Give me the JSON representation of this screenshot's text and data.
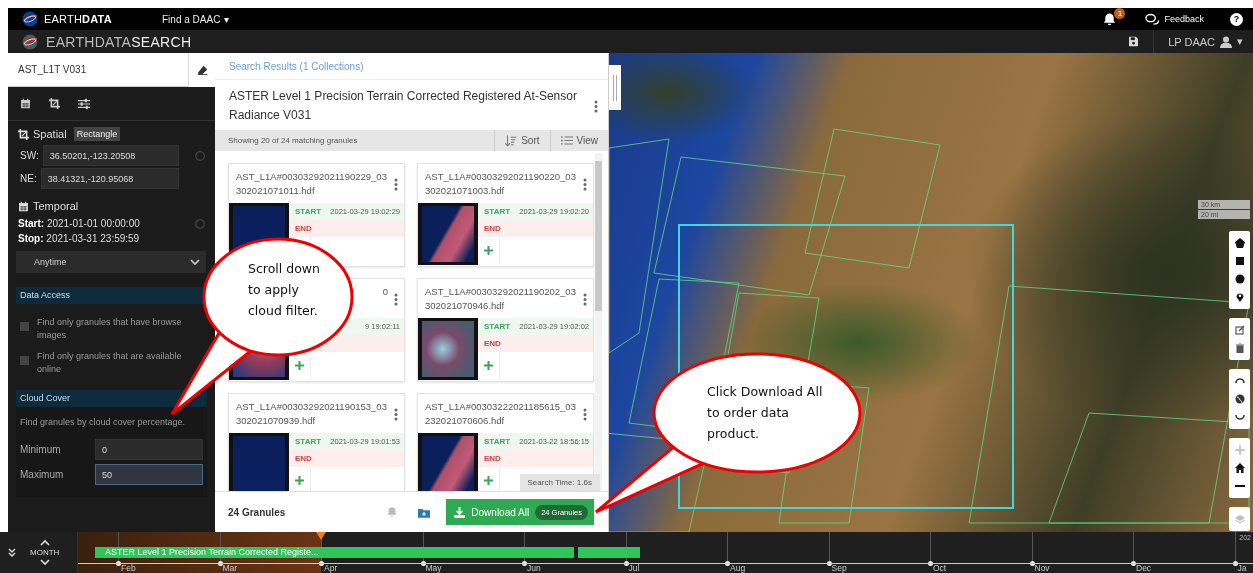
{
  "top_bar": {
    "brand": "EARTH**DATA**",
    "menu": "Find a DAAC",
    "menu_caret": "▾",
    "notification_count": "1",
    "feedback": "Feedback",
    "help": "?"
  },
  "app_bar": {
    "title": "EARTHDATA**SEARCH**",
    "account": "LP DAAC",
    "account_caret": "▾"
  },
  "sidebar": {
    "search": {
      "value": "AST_L1T V031"
    },
    "spatial": {
      "heading": "Spatial",
      "shape": "Rectangle",
      "fields": [
        {
          "label": "SW:",
          "value": "36.50201,-123.20508"
        },
        {
          "label": "NE:",
          "value": "38.41321,-120.95068"
        }
      ]
    },
    "temporal": {
      "heading": "Temporal",
      "start": "**Start:** 2021-01-01 00:00:00",
      "stop": "**Stop:** 2021-03-31 23:59:59",
      "recurring": "Anytime"
    },
    "data_access": {
      "heading": "Data Access",
      "options": [
        {
          "label": "Find only granules that have browse images",
          "checked": false
        },
        {
          "label": "Find only granules that are available online",
          "checked": false
        }
      ]
    },
    "cloud_cover": {
      "heading": "Cloud Cover",
      "description": "Find granules by cloud cover percentage.",
      "fields": [
        {
          "label": "Minimum",
          "value": "0",
          "focused": false
        },
        {
          "label": "Maximum",
          "value": "50",
          "focused": true
        }
      ]
    }
  },
  "results": {
    "breadcrumb": "Search Results (1 Collections)",
    "collection_title": "ASTER Level 1 Precision Terrain Corrected Registered At-Sensor Radiance V031",
    "summary": "Showing 20 of 24 matching granules",
    "sort": "Sort",
    "view": "View",
    "granules": [
      {
        "kind": "full",
        "title": "AST_L1A#00303292021190229_03302021071011.hdf",
        "start_label": "START",
        "start": "2021-03-29 19:02:29",
        "end_label": "END"
      },
      {
        "kind": "full",
        "title": "AST_L1A#00303292021190220_03302021071003.hdf",
        "start_label": "START",
        "start": "2021-03-29 19:02:20",
        "end_label": "END"
      },
      {
        "kind": "partial",
        "title": "0",
        "start": "9 19:02:11"
      },
      {
        "kind": "full",
        "title": "AST_L1A#00303292021190202_03302021070946.hdf",
        "start_label": "START",
        "start": "2021-03-29 19:02:02",
        "end_label": "END"
      },
      {
        "kind": "full",
        "title": "AST_L1A#00303292021190153_03302021070939.hdf",
        "start_label": "START",
        "start": "2021-03-29 19:01:53",
        "end_label": "END"
      },
      {
        "kind": "full",
        "title": "AST_L1A#00303222021185615_03232021070606.hdf",
        "start_label": "START",
        "start": "2021-03-22 18:56:15",
        "end_label": "END"
      }
    ],
    "search_time": "Search Time: 1.6s",
    "granule_count": "24 Granules",
    "download": "Download All",
    "download_badge": "24 Granules"
  },
  "map": {
    "scale": [
      "30 km",
      "20 mi"
    ]
  },
  "timeline": {
    "zoom": "MONTH",
    "year": "202",
    "bar_label": "ASTER Level 1 Precision Terrain Corrected Registe...",
    "months": [
      "Feb",
      "Mar",
      "Apr",
      "May",
      "Jun",
      "Jul",
      "Aug",
      "Sep",
      "Oct",
      "Nov",
      "Dec",
      "Ja"
    ]
  },
  "callouts": [
    {
      "text": "Scroll down to apply cloud filter."
    },
    {
      "text": "Click Download All to order data product."
    }
  ]
}
